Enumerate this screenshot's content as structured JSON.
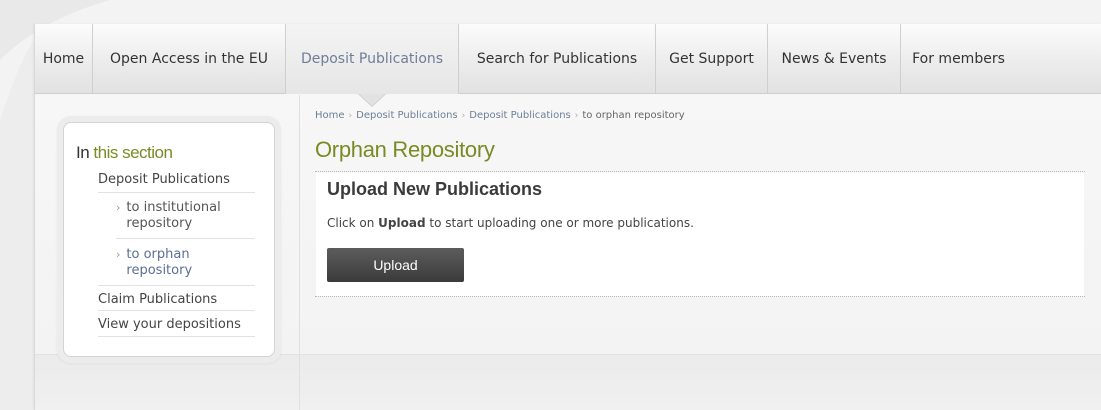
{
  "nav": {
    "items": [
      {
        "label": "Home"
      },
      {
        "label": "Open Access in the EU"
      },
      {
        "label": "Deposit Publications",
        "active": true
      },
      {
        "label": "Search for Publications"
      },
      {
        "label": "Get Support"
      },
      {
        "label": "News & Events"
      },
      {
        "label": "For members"
      }
    ]
  },
  "sidebar": {
    "title_prefix": "In",
    "title_rest": " this section",
    "links": {
      "deposit": "Deposit Publications",
      "institutional": "to institutional repository",
      "orphan": "to orphan repository",
      "claim": "Claim Publications",
      "view": "View your depositions"
    }
  },
  "breadcrumb": {
    "items": [
      "Home",
      "Deposit Publications",
      "Deposit Publications",
      "to orphan repository"
    ]
  },
  "main": {
    "title": "Orphan Repository",
    "panel": {
      "heading": "Upload New Publications",
      "text_before": "Click on ",
      "text_bold": "Upload",
      "text_after": " to start uploading one or more publications.",
      "button_label": "Upload"
    }
  },
  "colors": {
    "accent_green": "#7a8a24",
    "link_blue": "#6f7e96",
    "button_dark": "#3b3b3b"
  }
}
